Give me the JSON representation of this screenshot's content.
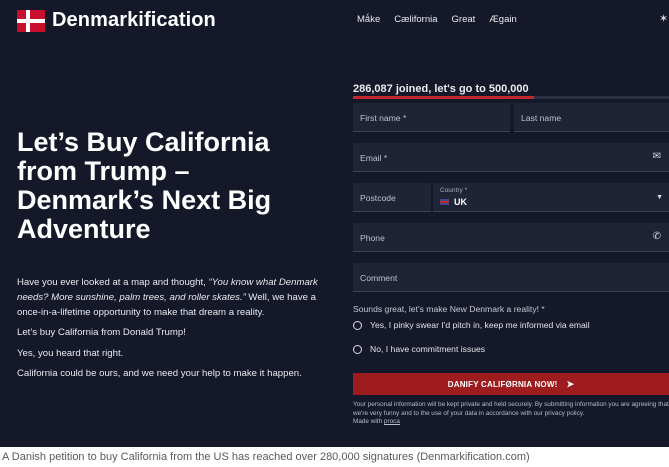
{
  "brand": {
    "name": "Denmarkification"
  },
  "nav": {
    "items": [
      "Mǻke",
      "Cælifornia",
      "Great",
      "Ægain"
    ]
  },
  "hero": {
    "title": "Let’s Buy California from Trump – Denmark’s Next Big Adventure",
    "intro_a": "Have you ever looked at a map and thought, ",
    "intro_quote": "“You know what Denmark needs? More sunshine, palm trees, and roller skates.”",
    "intro_b": " Well, we have a once-in-a-lifetime opportunity to make that dream a reality.",
    "p2": "Let’s buy California from Donald Trump!",
    "p3": "Yes, you heard that right.",
    "p4": "California could be ours, and we need your help to make it happen."
  },
  "form": {
    "counter_text": "286,087 joined, let's go to 500,000",
    "joined": 286087,
    "goal": 500000,
    "first_name": "First name *",
    "last_name": "Last name",
    "email": "Email *",
    "postcode": "Postcode",
    "country_label": "Country *",
    "country_value": "UK",
    "phone": "Phone",
    "comment": "Comment",
    "question": "Sounds great, let's make New Denmark a reality! *",
    "option_yes": "Yes, I pinky swear I'd pitch in, keep me informed via email",
    "option_no": "No, I have commitment issues",
    "submit": "DANIFY CALIFØRNIA NOW!",
    "disclaimer_1": "Your personal information will be kept private and held securely. By submitting information you are agreeing that we're very funny and to the use of your data in accordance with our privacy policy.",
    "made_with": "Made with ",
    "made_with_link": "proca"
  },
  "caption": "A Danish petition to buy California from the US has reached over 280,000 signatures (Denmarkification.com)",
  "colors": {
    "background": "#141829",
    "accent": "#9e1b1e",
    "flag_red": "#c8102e"
  },
  "icons": [
    "envelope-icon",
    "phone-icon",
    "send-icon",
    "chevron-down-icon"
  ]
}
